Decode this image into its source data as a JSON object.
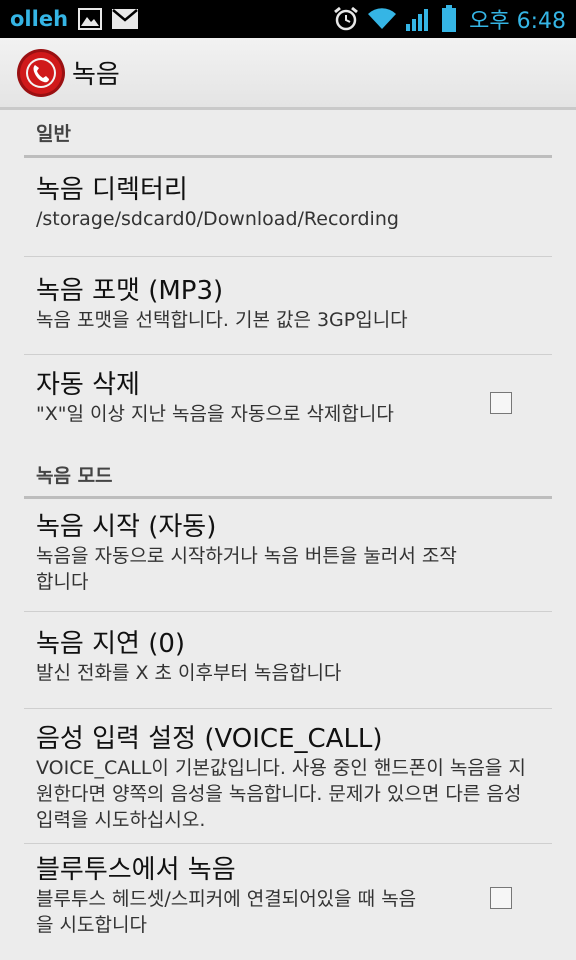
{
  "statusbar": {
    "carrier": "olleh",
    "time": "오후 6:48"
  },
  "actionbar": {
    "title": "녹음"
  },
  "sections": [
    {
      "header": "일반",
      "prefs": [
        {
          "title": "녹음 디렉터리",
          "summary": "/storage/sdcard0/Download/Recording"
        },
        {
          "title": "녹음 포맷 (MP3)",
          "summary": "녹음 포맷을 선택합니다. 기본 값은 3GP입니다"
        },
        {
          "title": "자동 삭제",
          "summary": "\"X\"일 이상 지난 녹음을 자동으로 삭제합니다",
          "checked": false
        }
      ]
    },
    {
      "header": "녹음 모드",
      "prefs": [
        {
          "title": "녹음 시작 (자동)",
          "summary": "녹음을 자동으로 시작하거나 녹음 버튼을 눌러서 조작합니다"
        },
        {
          "title": "녹음 지연 (0)",
          "summary": "발신 전화를 X 초 이후부터 녹음합니다"
        },
        {
          "title": "음성 입력 설정 (VOICE_CALL)",
          "summary": "VOICE_CALL이 기본값입니다. 사용 중인 핸드폰이 녹음을 지원한다면 양쪽의 음성을 녹음합니다. 문제가 있으면 다른 음성 입력을 시도하십시오."
        },
        {
          "title": "블루투스에서 녹음",
          "summary": "블루투스 헤드셋/스피커에 연결되어있을 때 녹음을 시도합니다",
          "checked": false
        }
      ]
    }
  ],
  "colors": {
    "statusbar_icon": "#35b5e5",
    "app_icon_red": "#d0191a"
  }
}
